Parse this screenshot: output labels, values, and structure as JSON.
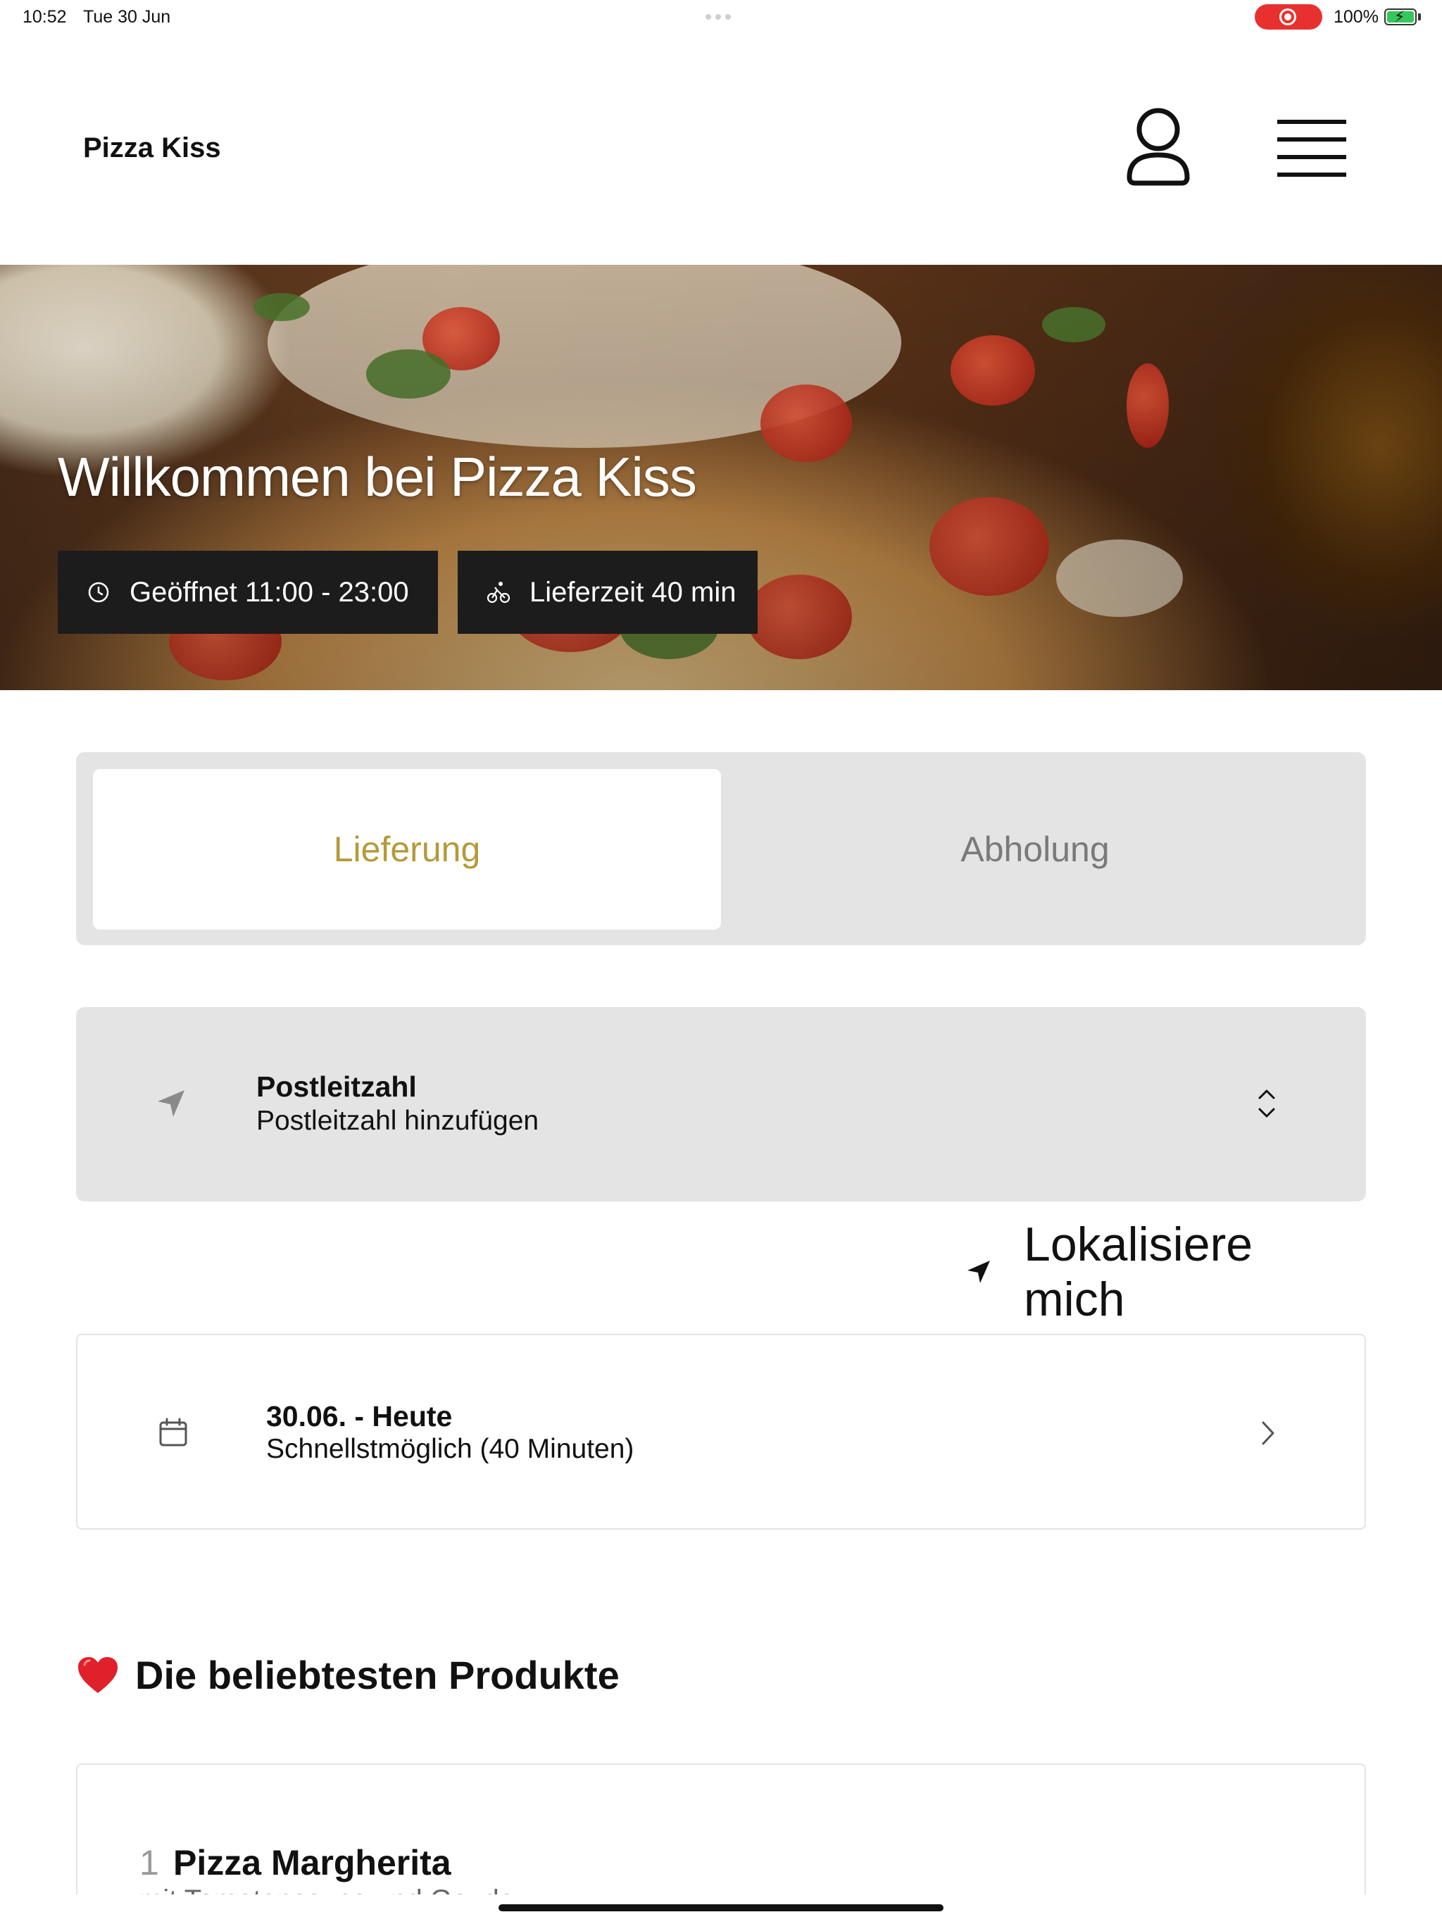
{
  "status_bar": {
    "time": "10:52",
    "date": "Tue 30 Jun",
    "battery": "100%"
  },
  "header": {
    "brand": "Pizza Kiss",
    "user_icon": "user-icon",
    "menu_icon": "hamburger-menu-icon"
  },
  "hero": {
    "title": "Willkommen bei Pizza Kiss",
    "opening": "Geöffnet 11:00 - 23:00",
    "delivery_time": "Lieferzeit 40 min"
  },
  "tabs": [
    {
      "label": "Lieferung",
      "active": true
    },
    {
      "label": "Abholung",
      "active": false
    }
  ],
  "postal": {
    "label": "Postleitzahl",
    "placeholder": "Postleitzahl hinzufügen"
  },
  "locate": {
    "label": "Lokalisiere mich"
  },
  "date_selector": {
    "date": "30.06. - Heute",
    "time": "Schnellstmöglich (40 Minuten)"
  },
  "popular": {
    "title": "Die beliebtesten Produkte",
    "products": [
      {
        "rank": "1",
        "name": "Pizza Margherita",
        "description": "mit Tomatensauce und Gouda"
      }
    ]
  },
  "colors": {
    "accent": "#b49a3a",
    "pill_bg": "#1c1c1c",
    "panel_bg": "#e4e4e4",
    "record_red": "#e8312f",
    "battery_green": "#34c759"
  }
}
